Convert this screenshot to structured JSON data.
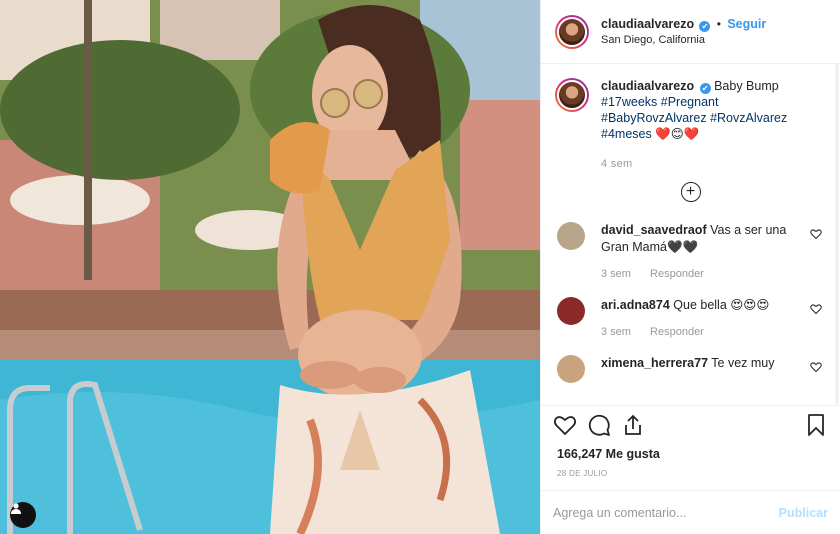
{
  "post": {
    "username": "claudiaalvarezo",
    "verified_mark": "✔",
    "separator": "•",
    "follow_label": "Seguir",
    "location": "San Diego, California"
  },
  "caption": {
    "username": "claudiaalvarezo",
    "text": "Baby Bump",
    "hashtags_line1": "#17weeks #Pregnant",
    "hashtags_line2": "#BabyRovzAlvarez #RovzAlvarez",
    "hashtags_line3": "#4meses",
    "emojis": "❤️😊❤️",
    "time": "4 sem"
  },
  "load_more_label": "+",
  "comments": [
    {
      "username": "david_saavedraof",
      "text": "Vas a ser una Gran Mamá🖤🖤",
      "time": "3 sem",
      "reply": "Responder",
      "avatar_color": "#b9a58a"
    },
    {
      "username": "ari.adna874",
      "text": "Que bella 😍😍😍",
      "time": "3 sem",
      "reply": "Responder",
      "avatar_color": "#8a2a2a"
    },
    {
      "username": "ximena_herrera77",
      "text": "Te vez muy",
      "time": "",
      "reply": "",
      "avatar_color": "#c9a27e"
    }
  ],
  "likes": "166,247 Me gusta",
  "date": "28 DE JULIO",
  "add_comment_placeholder": "Agrega un comentario...",
  "publish_label": "Publicar",
  "icons": [
    "like-heart-icon",
    "comment-bubble-icon",
    "share-icon",
    "save-bookmark-icon",
    "tag-person-icon",
    "add-circle-icon"
  ],
  "colors": {
    "link_blue": "#3897f0",
    "hashtag": "#003569",
    "muted": "#999999",
    "publish_disabled": "#b2dffc"
  }
}
